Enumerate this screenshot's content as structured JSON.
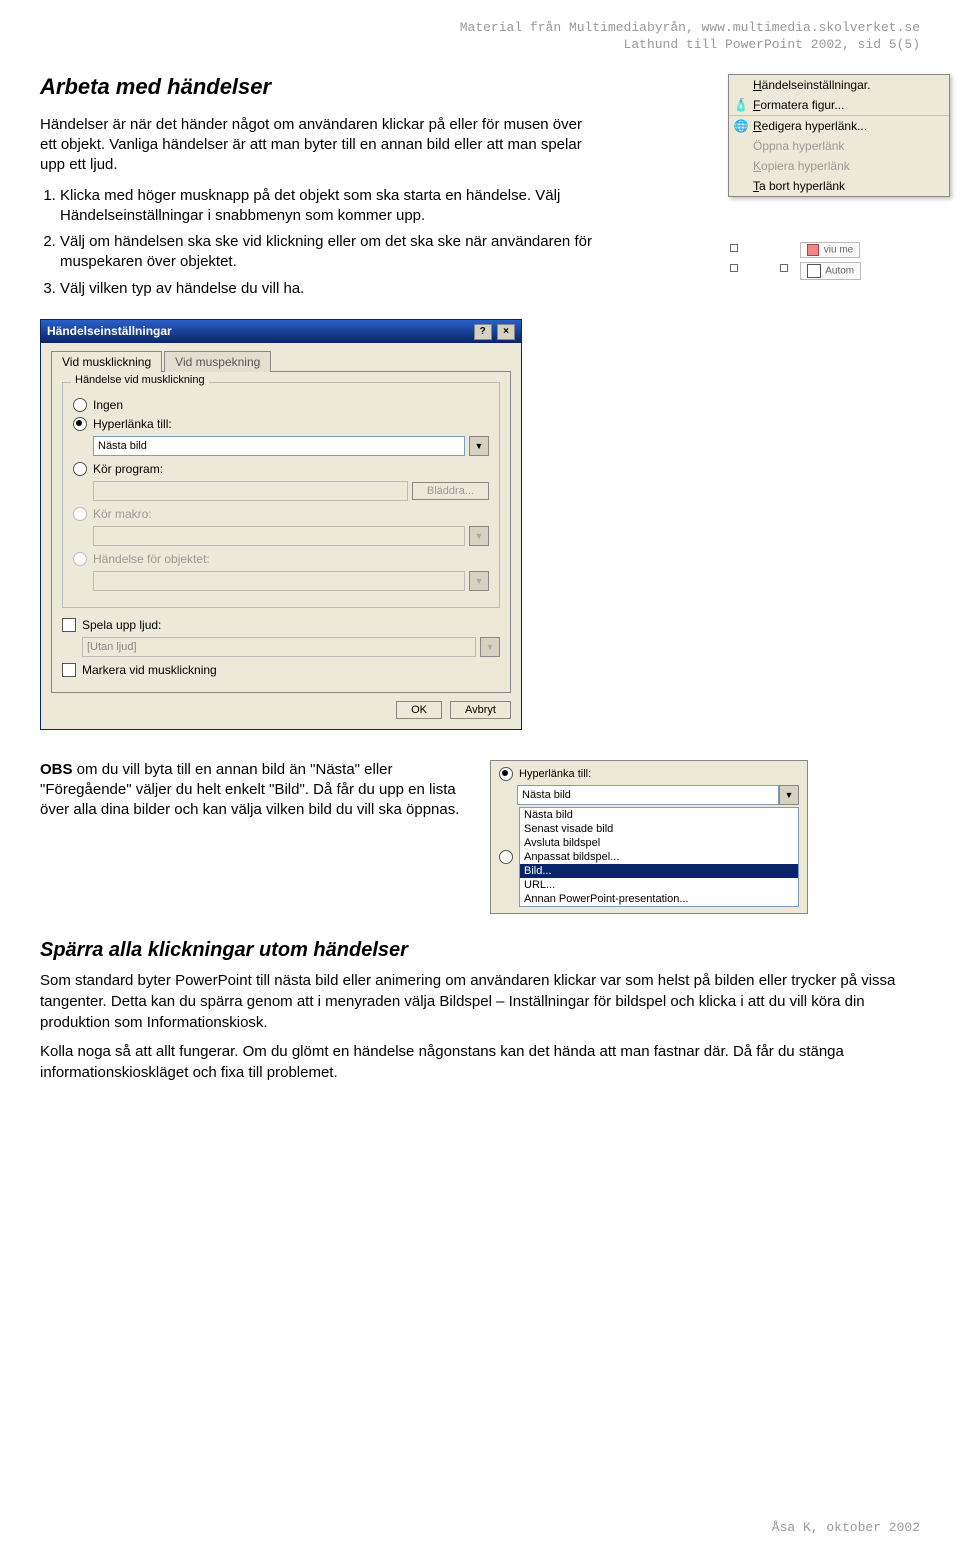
{
  "header": {
    "line1": "Material från Multimediabyrån, www.multimedia.skolverket.se",
    "line2": "Lathund till PowerPoint 2002, sid 5(5)"
  },
  "section1": {
    "title": "Arbeta med händelser",
    "intro": "Händelser är när det händer något om användaren klickar på eller för musen över ett objekt. Vanliga händelser är att man byter till en annan bild eller att man spelar upp ett ljud.",
    "steps": [
      "Klicka med höger musknapp på det objekt som ska starta en händelse. Välj Händelseinställningar i snabbmenyn som kommer upp.",
      "Välj om händelsen ska ske vid klickning eller om det ska ske när användaren för muspekaren över objektet.",
      "Välj vilken typ av händelse du vill ha."
    ]
  },
  "contextMenu": {
    "items": [
      {
        "icon": "",
        "label": "Händelseinställningar."
      },
      {
        "icon": "🎨",
        "label": "Formatera figur..."
      },
      {
        "icon": "🌐",
        "label": "Redigera hyperlänk..."
      },
      {
        "icon": "",
        "label": "Öppna hyperlänk",
        "disabled": true
      },
      {
        "icon": "",
        "label": "Kopiera hyperlänk",
        "disabled": true
      },
      {
        "icon": "",
        "label": "Ta bort hyperlänk"
      }
    ],
    "below1": "viu me",
    "below2": "Autom"
  },
  "dialog": {
    "title": "Händelseinställningar",
    "tab1": "Vid musklickning",
    "tab2": "Vid muspekning",
    "group_legend": "Händelse vid musklickning",
    "radio_none": "Ingen",
    "radio_hyper": "Hyperlänka till:",
    "hyper_value": "Nästa bild",
    "radio_run": "Kör program:",
    "browse": "Bläddra...",
    "radio_macro": "Kör makro:",
    "radio_objaction": "Händelse för objektet:",
    "check_sound": "Spela upp ljud:",
    "sound_value": "[Utan ljud]",
    "check_mark": "Markera vid musklickning",
    "ok": "OK",
    "cancel": "Avbryt"
  },
  "obs": {
    "text1": "OBS",
    "text2": " om du vill byta till en annan bild än \"Nästa\" eller \"Föregående\" väljer du helt enkelt \"Bild\". Då får du upp en lista över alla dina bilder och kan välja vilken bild du vill ska öppnas."
  },
  "dropdown": {
    "label": "Hyperlänka till:",
    "value": "Nästa bild",
    "items": [
      "Nästa bild",
      "Senast visade bild",
      "Avsluta bildspel",
      "Anpassat bildspel...",
      "Bild...",
      "URL...",
      "Annan PowerPoint-presentation..."
    ],
    "selected_index": 4
  },
  "section2": {
    "title": "Spärra alla klickningar utom händelser",
    "p1": "Som standard byter PowerPoint till nästa bild eller animering om användaren klickar var som helst på bilden eller trycker på vissa tangenter. Detta kan du spärra genom att i menyraden välja Bildspel – Inställningar för bildspel och klicka i att du vill köra din produktion som Informationskiosk.",
    "p2": "Kolla noga så att allt fungerar. Om du glömt en händelse någonstans kan det hända att man fastnar där. Då får du stänga informationskioskläget och fixa till problemet."
  },
  "footer": "Åsa K, oktober 2002"
}
